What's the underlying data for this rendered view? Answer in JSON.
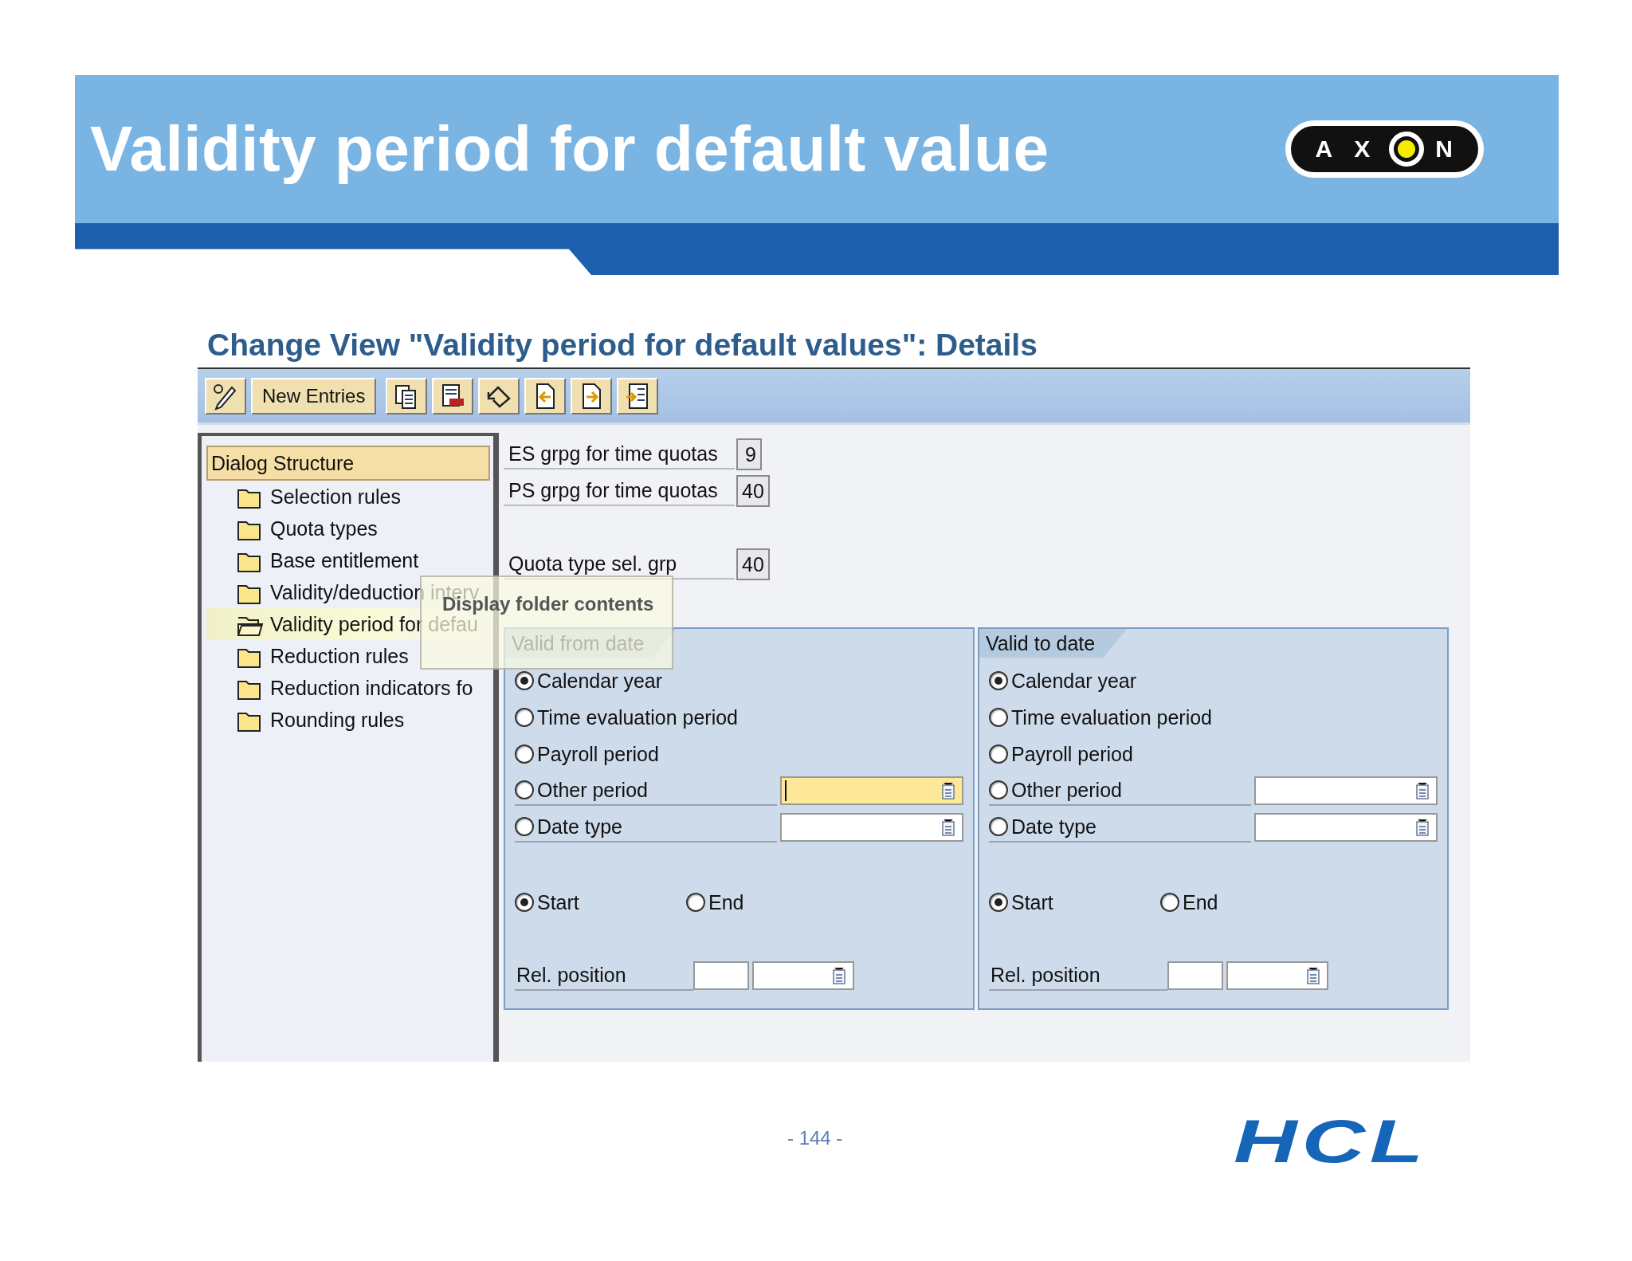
{
  "slide": {
    "title": "Validity period for default value",
    "logo": {
      "left": "A X",
      "right": "N"
    }
  },
  "screen": {
    "title": "Change View \"Validity period for default values\": Details",
    "toolbar": {
      "new_entries": "New Entries"
    },
    "tree": {
      "header": "Dialog Structure",
      "items": [
        {
          "label": "Selection rules",
          "selected": false
        },
        {
          "label": "Quota types",
          "selected": false
        },
        {
          "label": "Base entitlement",
          "selected": false
        },
        {
          "label": "Validity/deduction interv",
          "selected": false
        },
        {
          "label": "Validity period for defau",
          "selected": true
        },
        {
          "label": "Reduction rules",
          "selected": false
        },
        {
          "label": "Reduction indicators fo",
          "selected": false
        },
        {
          "label": "Rounding rules",
          "selected": false
        }
      ]
    },
    "fields": [
      {
        "label": "ES grpg for time quotas",
        "value": "9"
      },
      {
        "label": "PS grpg for time quotas",
        "value": "40"
      },
      {
        "label": "Quota type sel. grp",
        "value": "40"
      }
    ],
    "groups": [
      {
        "title": "Valid from date",
        "options": [
          {
            "label": "Calendar year",
            "selected": true
          },
          {
            "label": "Time evaluation period",
            "selected": false
          },
          {
            "label": "Payroll period",
            "selected": false
          },
          {
            "label": "Other period",
            "selected": false,
            "input": {
              "focused": true
            }
          },
          {
            "label": "Date type",
            "selected": false,
            "input": {
              "focused": false
            }
          }
        ],
        "anchor": [
          {
            "label": "Start",
            "selected": true
          },
          {
            "label": "End",
            "selected": false
          }
        ],
        "rel_position": "Rel. position"
      },
      {
        "title": "Valid to date",
        "options": [
          {
            "label": "Calendar year",
            "selected": true
          },
          {
            "label": "Time evaluation period",
            "selected": false
          },
          {
            "label": "Payroll period",
            "selected": false
          },
          {
            "label": "Other period",
            "selected": false,
            "input": {
              "focused": false
            }
          },
          {
            "label": "Date type",
            "selected": false,
            "input": {
              "focused": false
            }
          }
        ],
        "anchor": [
          {
            "label": "Start",
            "selected": true
          },
          {
            "label": "End",
            "selected": false
          }
        ],
        "rel_position": "Rel. position"
      }
    ],
    "tooltip": "Display folder contents"
  },
  "footer": {
    "page_number": "- 144 -",
    "logo": "HCL"
  }
}
